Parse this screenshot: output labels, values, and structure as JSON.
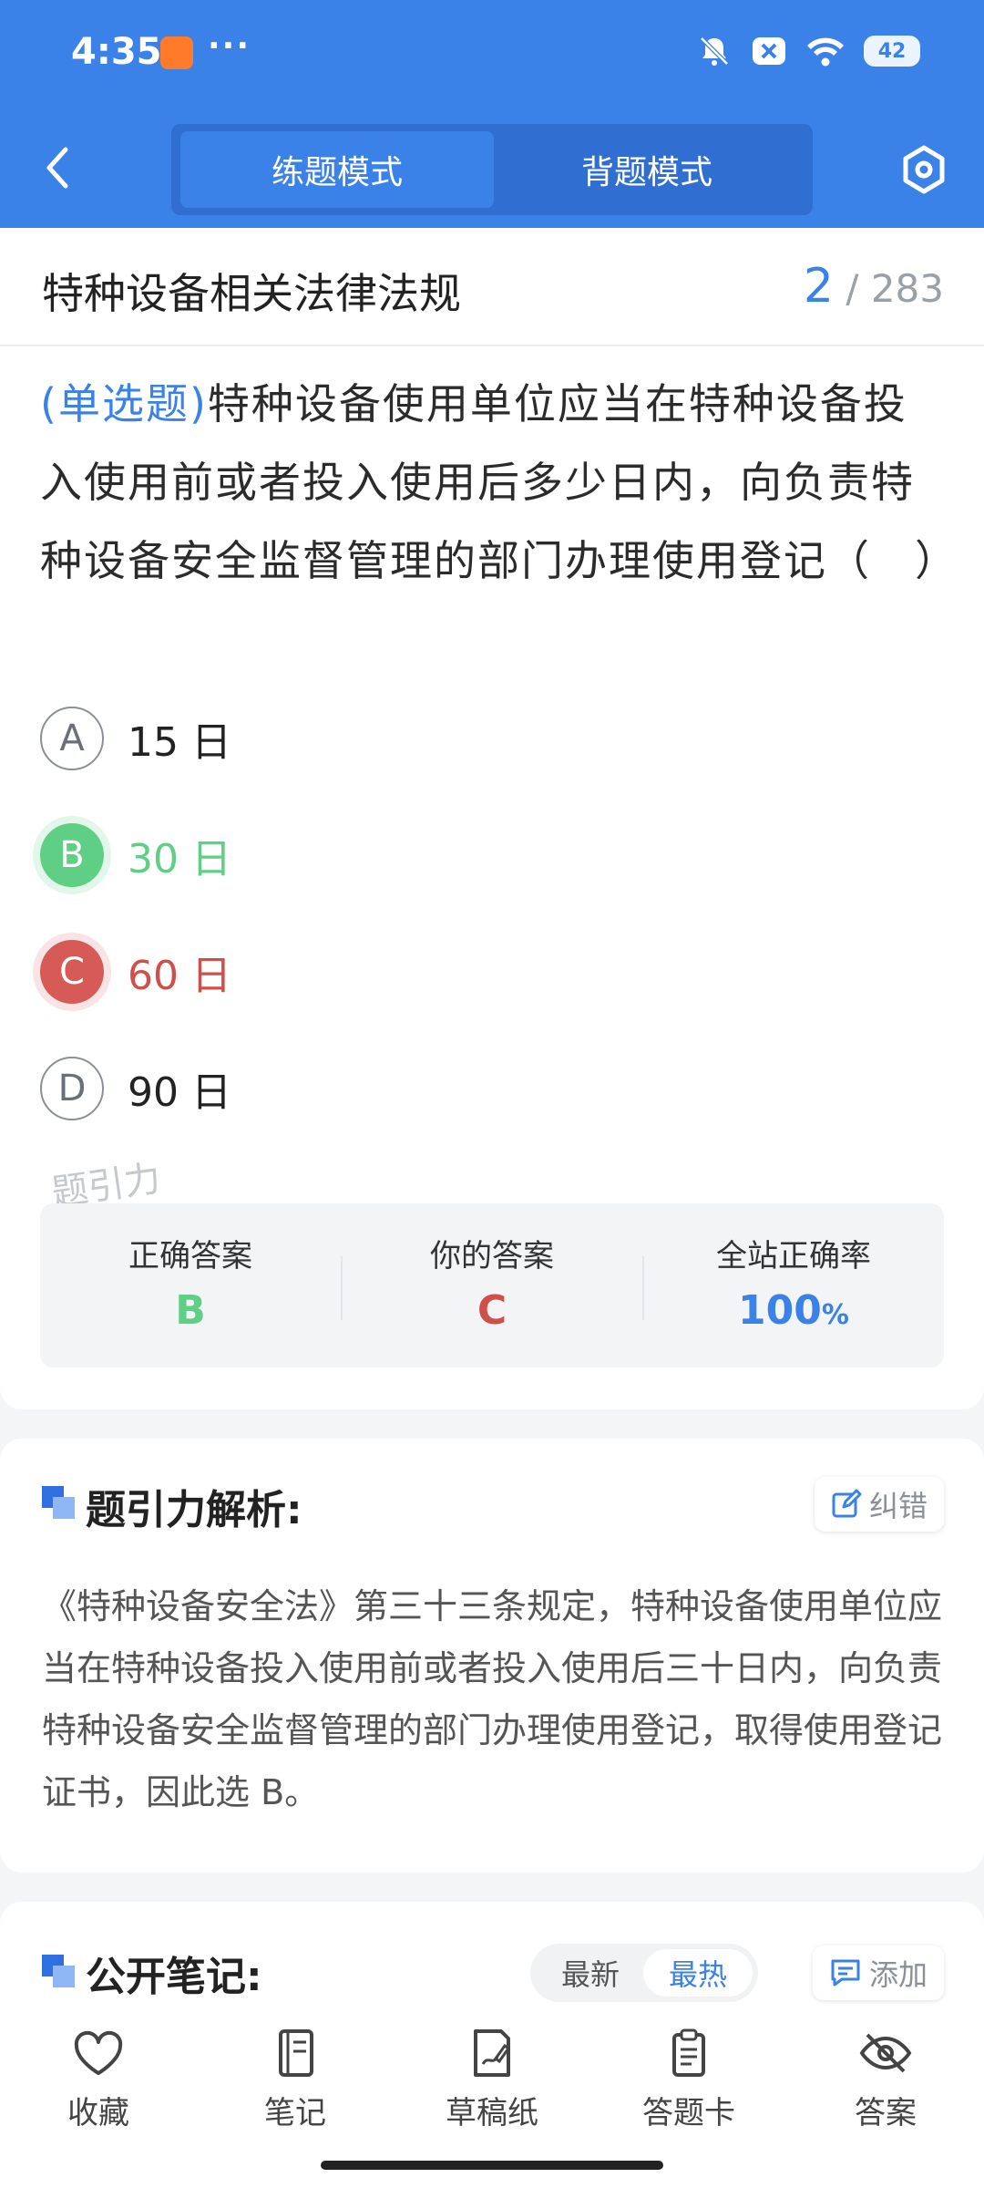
{
  "status_bar": {
    "time": "4:35",
    "more": "···",
    "battery": "42"
  },
  "nav": {
    "tabs": [
      "练题模式",
      "背题模式"
    ],
    "active_tab": 0
  },
  "question": {
    "chapter": "特种设备相关法律法规",
    "current": "2",
    "total": "/ 283",
    "type": "(单选题)",
    "text": "特种设备使用单位应当在特种设备投入使用前或者投入使用后多少日内，向负责特种设备安全监督管理的部门办理使用登记（　）",
    "options": [
      {
        "letter": "A",
        "text": "15 日",
        "state": "normal"
      },
      {
        "letter": "B",
        "text": "30 日",
        "state": "correct"
      },
      {
        "letter": "C",
        "text": "60 日",
        "state": "wrong"
      },
      {
        "letter": "D",
        "text": "90 日",
        "state": "normal"
      }
    ],
    "watermark": "题引力"
  },
  "result": {
    "correct_label": "正确答案",
    "correct_value": "B",
    "yours_label": "你的答案",
    "yours_value": "C",
    "rate_label": "全站正确率",
    "rate_value": "100",
    "rate_unit": "%"
  },
  "analysis": {
    "title": "题引力解析:",
    "correct_btn": "纠错",
    "text": "《特种设备安全法》第三十三条规定，特种设备使用单位应当在特种设备投入使用前或者投入使用后三十日内，向负责特种设备安全监督管理的部门办理使用登记，取得使用登记证书，因此选 B。"
  },
  "notes": {
    "title": "公开笔记:",
    "sort": [
      "最新",
      "最热"
    ],
    "active_sort": 1,
    "add_btn": "添加"
  },
  "toolbar": {
    "items": [
      "收藏",
      "笔记",
      "草稿纸",
      "答题卡",
      "答案"
    ]
  },
  "colors": {
    "primary": "#3b82e8",
    "correct": "#5fcf86",
    "wrong": "#d65a55"
  }
}
